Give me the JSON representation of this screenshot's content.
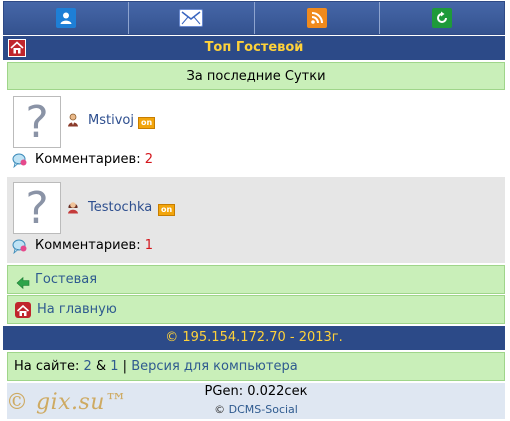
{
  "header": {
    "nav": [
      {
        "icon": "user-icon",
        "color": "#1e7fd6"
      },
      {
        "icon": "mail-icon",
        "color": "#ffffff"
      },
      {
        "icon": "rss-icon",
        "color": "#f08a1c"
      },
      {
        "icon": "refresh-icon",
        "color": "#1e9a3a"
      }
    ],
    "title": "Топ Гостевой"
  },
  "period": "За последние Сутки",
  "entries": [
    {
      "avatar": "?",
      "name": "Mstivoj",
      "online": "on",
      "comments_label": "Комментариев:",
      "comments": "2"
    },
    {
      "avatar": "?",
      "name": "Testochka",
      "online": "on",
      "comments_label": "Комментариев:",
      "comments": "1"
    }
  ],
  "links": {
    "guestbook": "Гостевая",
    "home": "На главную"
  },
  "footer": {
    "copyright": "© 195.154.172.70 - 2013г.",
    "online_label": "На сайте:",
    "online_a": "2",
    "amp": "&",
    "online_b": "1",
    "sep": "|",
    "desktop": "Версия для компьютера",
    "pgen": "PGen: 0.022сек",
    "copy_sign": "©",
    "engine": "DCMS-Social",
    "watermark": "© gix.su™"
  },
  "colors": {
    "accent": "#2c4a88",
    "title": "#ffd23a",
    "green": "#c9efb9",
    "count": "#d4151b"
  }
}
